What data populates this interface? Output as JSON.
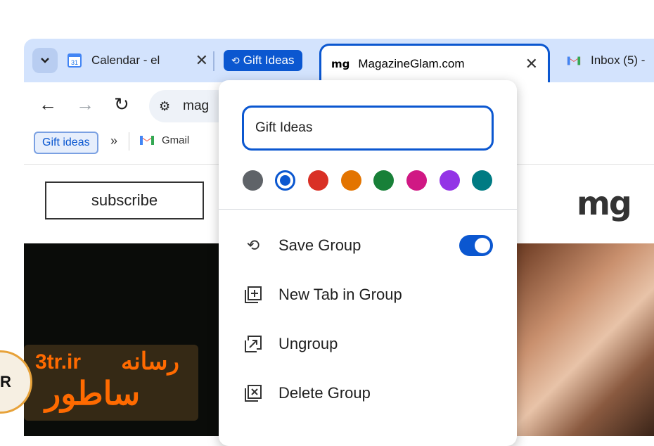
{
  "tabs": {
    "calendar": {
      "title": "Calendar - el",
      "icon": "calendar-icon",
      "day": "31"
    },
    "group_chip": "Gift Ideas",
    "active": {
      "favicon_text": "mg",
      "title": "MagazineGlam.com"
    },
    "inbox": {
      "title": "Inbox (5) -"
    }
  },
  "toolbar": {
    "omnibox_text": "mag"
  },
  "bookmarks": {
    "gift_ideas": "Gift ideas",
    "more": "»",
    "gmail": "Gmail"
  },
  "page": {
    "subscribe": "subscribe",
    "logo": "mg"
  },
  "popup": {
    "group_name_value": "Gift Ideas",
    "colors": [
      "#5f6368",
      "#0b57d0",
      "#d93025",
      "#e37400",
      "#188038",
      "#d01884",
      "#9334e6",
      "#007b83"
    ],
    "selected_color_index": 1,
    "menu": [
      {
        "label": "Save Group",
        "icon": "save-group-icon"
      },
      {
        "label": "New Tab in Group",
        "icon": "new-tab-icon"
      },
      {
        "label": "Ungroup",
        "icon": "ungroup-icon"
      },
      {
        "label": "Delete Group",
        "icon": "delete-group-icon"
      }
    ],
    "save_group_enabled": true
  },
  "watermark": {
    "site": "3tr.ir",
    "line1": "رسانه",
    "line2": "ساطور",
    "badge": "R"
  }
}
